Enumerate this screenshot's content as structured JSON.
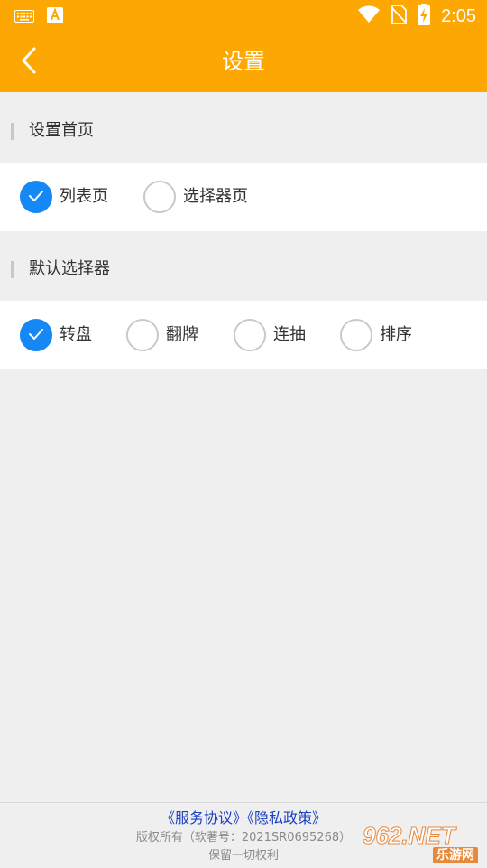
{
  "status_bar": {
    "time": "2:05"
  },
  "app_bar": {
    "title": "设置"
  },
  "sections": [
    {
      "header": "设置首页",
      "options": [
        {
          "label": "列表页",
          "checked": true
        },
        {
          "label": "选择器页",
          "checked": false
        }
      ]
    },
    {
      "header": "默认选择器",
      "options": [
        {
          "label": "转盘",
          "checked": true
        },
        {
          "label": "翻牌",
          "checked": false
        },
        {
          "label": "连抽",
          "checked": false
        },
        {
          "label": "排序",
          "checked": false
        }
      ]
    }
  ],
  "footer": {
    "service_agreement": "《服务协议》",
    "privacy_policy": "《隐私政策》",
    "copyright": "版权所有（软著号：2021SR0695268）",
    "rights": "保留一切权利"
  },
  "watermark": {
    "main": "962.NET",
    "sub": "乐游网"
  },
  "colors": {
    "accent": "#fda802",
    "checked": "#1588f5",
    "link": "#1a3fc4"
  }
}
